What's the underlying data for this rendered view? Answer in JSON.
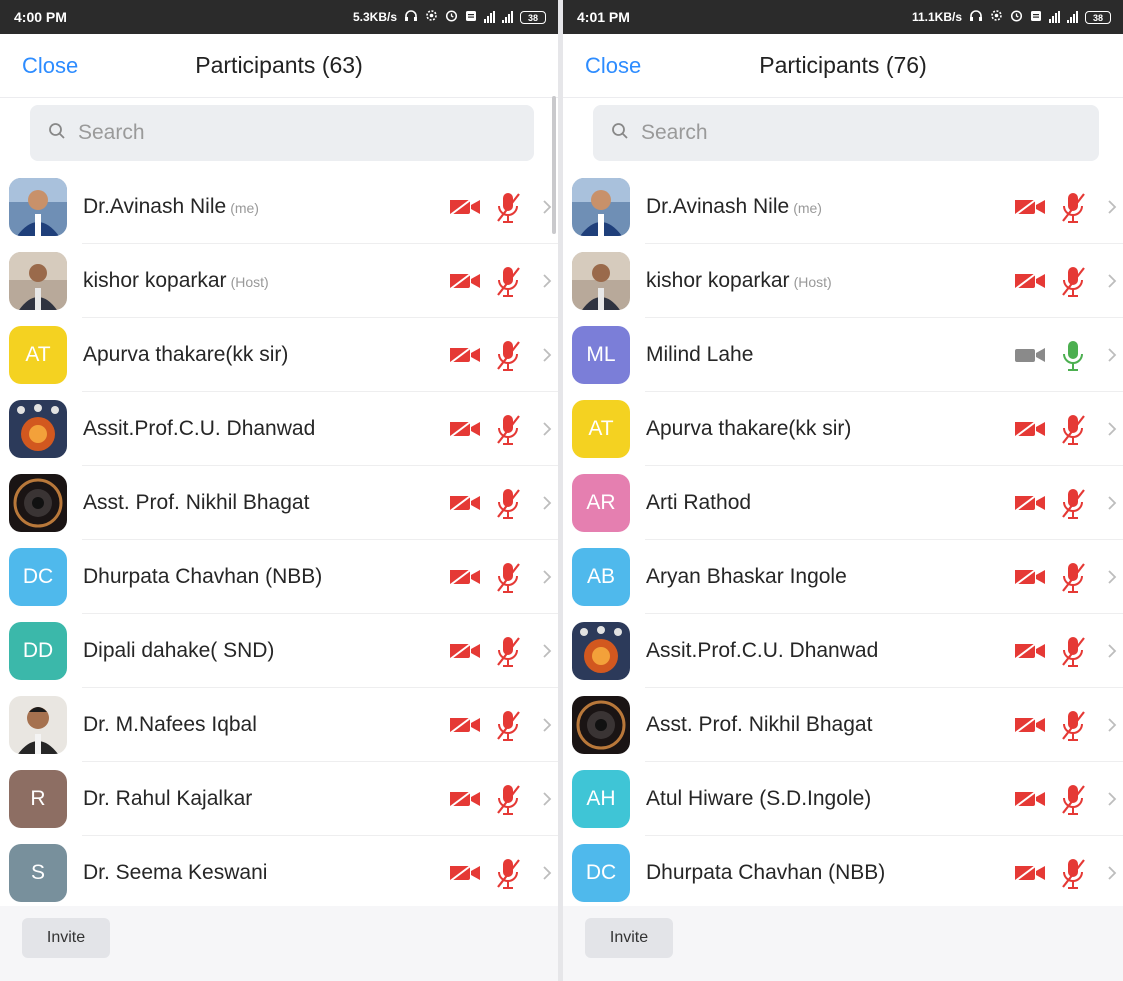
{
  "colors": {
    "accent": "#2d8cff",
    "muted_red": "#e53935",
    "active_green": "#4caf50",
    "video_gray": "#8a8a8a"
  },
  "screens": [
    {
      "status": {
        "time": "4:00 PM",
        "speed": "5.3KB/s",
        "battery": "38"
      },
      "header": {
        "close": "Close",
        "title": "Participants (63)"
      },
      "search_placeholder": "Search",
      "participants": [
        {
          "name": "Dr.Avinash Nile",
          "role": "(me)",
          "avatar": "photo-1",
          "video_muted": true,
          "mic_muted": true
        },
        {
          "name": "kishor koparkar",
          "role": "(Host)",
          "avatar": "photo-2",
          "video_muted": true,
          "mic_muted": true
        },
        {
          "name": "Apurva thakare(kk sir)",
          "role": "",
          "avatar_text": "AT",
          "avatar_color": "#f4d221",
          "video_muted": true,
          "mic_muted": true
        },
        {
          "name": "Assit.Prof.C.U. Dhanwad",
          "role": "",
          "avatar": "photo-3",
          "video_muted": true,
          "mic_muted": true
        },
        {
          "name": "Asst. Prof. Nikhil Bhagat",
          "role": "",
          "avatar": "photo-4",
          "video_muted": true,
          "mic_muted": true
        },
        {
          "name": "Dhurpata Chavhan (NBB)",
          "role": "",
          "avatar_text": "DC",
          "avatar_color": "#4fb9ec",
          "video_muted": true,
          "mic_muted": true
        },
        {
          "name": "Dipali dahake( SND)",
          "role": "",
          "avatar_text": "DD",
          "avatar_color": "#3bb8aa",
          "video_muted": true,
          "mic_muted": true
        },
        {
          "name": "Dr. M.Nafees Iqbal",
          "role": "",
          "avatar": "photo-5",
          "video_muted": true,
          "mic_muted": true
        },
        {
          "name": "Dr. Rahul Kajalkar",
          "role": "",
          "avatar_text": "R",
          "avatar_color": "#8d6e63",
          "video_muted": true,
          "mic_muted": true
        },
        {
          "name": "Dr. Seema Keswani",
          "role": "",
          "avatar_text": "S",
          "avatar_color": "#78909c",
          "video_muted": true,
          "mic_muted": true
        }
      ],
      "invite": "Invite"
    },
    {
      "status": {
        "time": "4:01 PM",
        "speed": "11.1KB/s",
        "battery": "38"
      },
      "header": {
        "close": "Close",
        "title": "Participants (76)"
      },
      "search_placeholder": "Search",
      "participants": [
        {
          "name": "Dr.Avinash Nile",
          "role": "(me)",
          "avatar": "photo-1",
          "video_muted": true,
          "mic_muted": true
        },
        {
          "name": "kishor koparkar",
          "role": "(Host)",
          "avatar": "photo-2",
          "video_muted": true,
          "mic_muted": true
        },
        {
          "name": "Milind Lahe",
          "role": "",
          "avatar_text": "ML",
          "avatar_color": "#7b7ed8",
          "video_muted": false,
          "mic_muted": false
        },
        {
          "name": "Apurva thakare(kk sir)",
          "role": "",
          "avatar_text": "AT",
          "avatar_color": "#f4d221",
          "video_muted": true,
          "mic_muted": true
        },
        {
          "name": "Arti Rathod",
          "role": "",
          "avatar_text": "AR",
          "avatar_color": "#e57fb0",
          "video_muted": true,
          "mic_muted": true
        },
        {
          "name": "Aryan Bhaskar Ingole",
          "role": "",
          "avatar_text": "AB",
          "avatar_color": "#4fb9ec",
          "video_muted": true,
          "mic_muted": true
        },
        {
          "name": "Assit.Prof.C.U. Dhanwad",
          "role": "",
          "avatar": "photo-3",
          "video_muted": true,
          "mic_muted": true
        },
        {
          "name": "Asst. Prof. Nikhil Bhagat",
          "role": "",
          "avatar": "photo-4",
          "video_muted": true,
          "mic_muted": true
        },
        {
          "name": "Atul Hiware (S.D.Ingole)",
          "role": "",
          "avatar_text": "AH",
          "avatar_color": "#3fc5d6",
          "video_muted": true,
          "mic_muted": true
        },
        {
          "name": "Dhurpata Chavhan (NBB)",
          "role": "",
          "avatar_text": "DC",
          "avatar_color": "#4fb9ec",
          "video_muted": true,
          "mic_muted": true
        }
      ],
      "invite": "Invite"
    }
  ]
}
